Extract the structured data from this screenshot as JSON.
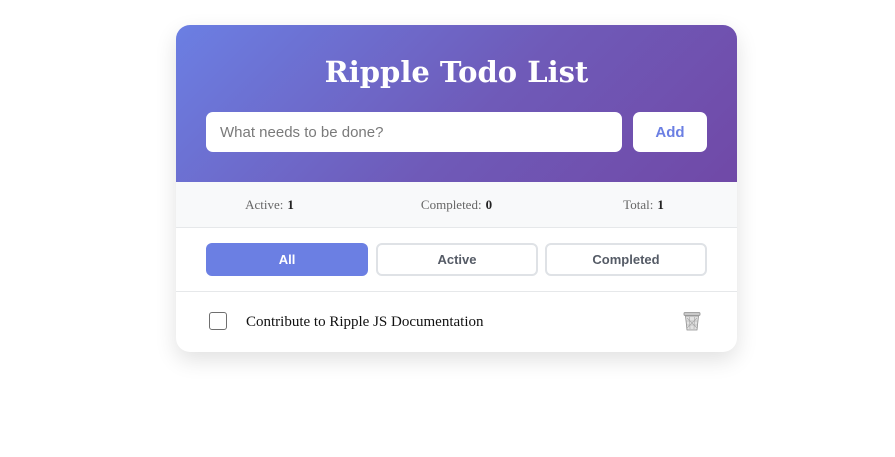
{
  "app": {
    "title": "Ripple Todo List"
  },
  "new_todo": {
    "placeholder": "What needs to be done?",
    "value": "",
    "add_label": "Add"
  },
  "stats": {
    "active_label": "Active:",
    "active_count": "1",
    "completed_label": "Completed:",
    "completed_count": "0",
    "total_label": "Total:",
    "total_count": "1"
  },
  "filters": {
    "selected": "All",
    "items": [
      {
        "label": "All"
      },
      {
        "label": "Active"
      },
      {
        "label": "Completed"
      }
    ]
  },
  "todos": [
    {
      "text": "Contribute to Ripple JS Documentation",
      "completed": false,
      "delete_icon": "trash-icon"
    }
  ],
  "colors": {
    "accent": "#6b7fe3",
    "header_gradient_start": "#6b7fe3",
    "header_gradient_end": "#7049a7"
  }
}
